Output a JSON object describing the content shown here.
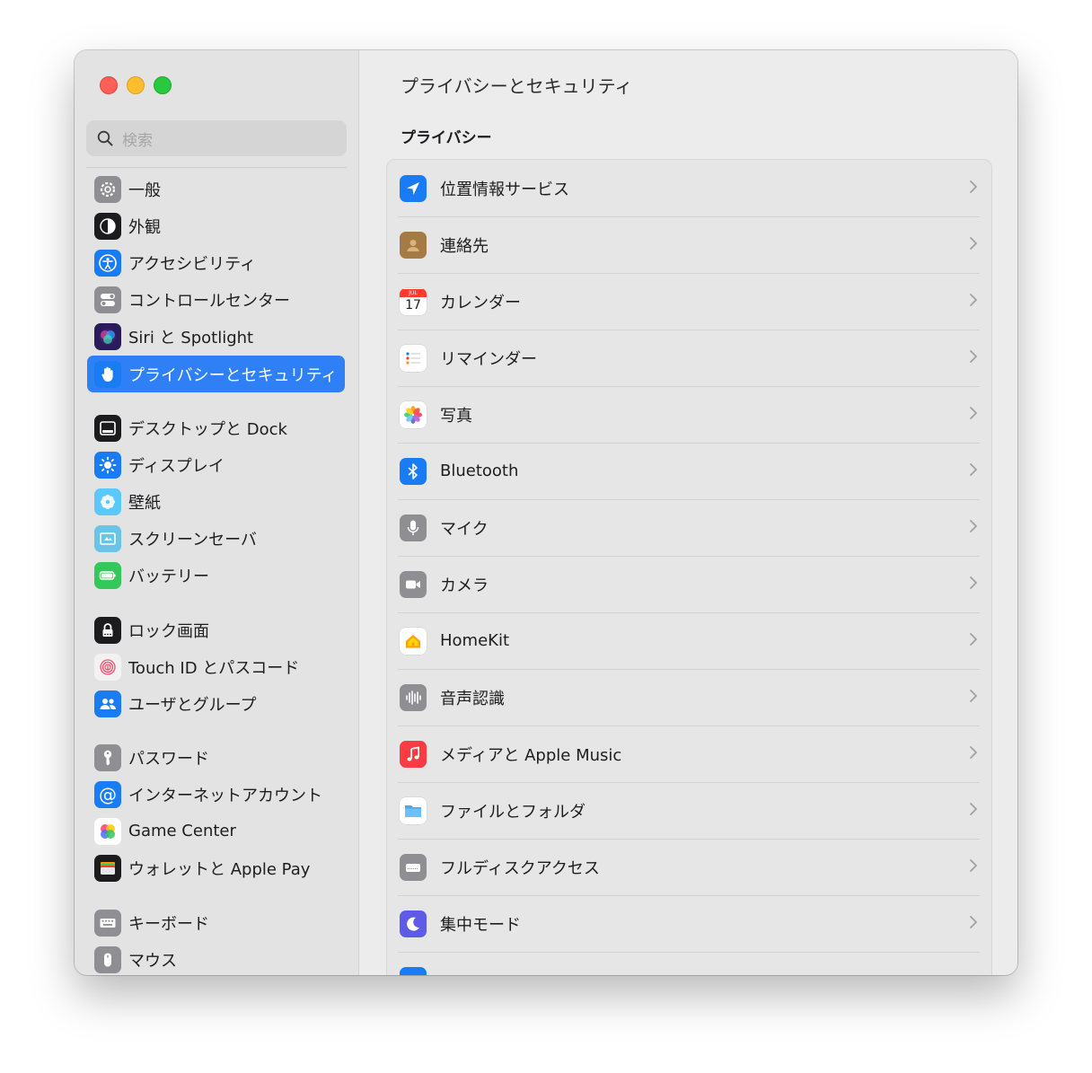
{
  "window": {
    "title": "プライバシーとセキュリティ"
  },
  "search": {
    "placeholder": "検索"
  },
  "sidebar": {
    "items": [
      {
        "label": "一般",
        "icon": "gear-icon",
        "color": "#8e8e93"
      },
      {
        "label": "外観",
        "icon": "appearance-icon",
        "color": "#1c1c1e"
      },
      {
        "label": "アクセシビリティ",
        "icon": "accessibility-icon",
        "color": "#1a7cf5"
      },
      {
        "label": "コントロールセンター",
        "icon": "control-center-icon",
        "color": "#8e8e93"
      },
      {
        "label": "Siri と Spotlight",
        "icon": "siri-icon",
        "color": "#2b1b5a"
      },
      {
        "label": "プライバシーとセキュリティ",
        "icon": "hand-icon",
        "color": "#1a7cf5",
        "selected": true
      },
      {
        "label": "デスクトップと Dock",
        "icon": "dock-icon",
        "color": "#1c1c1e"
      },
      {
        "label": "ディスプレイ",
        "icon": "display-icon",
        "color": "#1a7cf5"
      },
      {
        "label": "壁紙",
        "icon": "wallpaper-icon",
        "color": "#5ac8fa"
      },
      {
        "label": "スクリーンセーバ",
        "icon": "screensaver-icon",
        "color": "#6ac4e8"
      },
      {
        "label": "バッテリー",
        "icon": "battery-icon",
        "color": "#34c759"
      },
      {
        "label": "ロック画面",
        "icon": "lock-icon",
        "color": "#1c1c1e"
      },
      {
        "label": "Touch ID とパスコード",
        "icon": "fingerprint-icon",
        "color": "#f2f2f2"
      },
      {
        "label": "ユーザとグループ",
        "icon": "users-icon",
        "color": "#1a7cf5"
      },
      {
        "label": "パスワード",
        "icon": "key-icon",
        "color": "#8e8e93"
      },
      {
        "label": "インターネットアカウント",
        "icon": "at-icon",
        "color": "#1a7cf5"
      },
      {
        "label": "Game Center",
        "icon": "game-center-icon",
        "color": "#ffffff"
      },
      {
        "label": "ウォレットと Apple Pay",
        "icon": "wallet-icon",
        "color": "#1c1c1e"
      },
      {
        "label": "キーボード",
        "icon": "keyboard-icon",
        "color": "#8e8e93"
      },
      {
        "label": "マウス",
        "icon": "mouse-icon",
        "color": "#8e8e93"
      }
    ]
  },
  "main": {
    "title": "プライバシーとセキュリティ",
    "section_title": "プライバシー",
    "rows": [
      {
        "label": "位置情報サービス",
        "icon": "location-arrow-icon",
        "color": "#1a7cf5"
      },
      {
        "label": "連絡先",
        "icon": "contacts-icon",
        "color": "#a57a45"
      },
      {
        "label": "カレンダー",
        "icon": "calendar-icon",
        "color": "#ffffff",
        "calendar_month": "JUL",
        "calendar_day": "17"
      },
      {
        "label": "リマインダー",
        "icon": "reminders-icon",
        "color": "#ffffff"
      },
      {
        "label": "写真",
        "icon": "photos-icon",
        "color": "#ffffff"
      },
      {
        "label": "Bluetooth",
        "icon": "bluetooth-icon",
        "color": "#1a7cf5"
      },
      {
        "label": "マイク",
        "icon": "microphone-icon",
        "color": "#8e8e93"
      },
      {
        "label": "カメラ",
        "icon": "camera-icon",
        "color": "#8e8e93"
      },
      {
        "label": "HomeKit",
        "icon": "home-icon",
        "color": "#ffffff"
      },
      {
        "label": "音声認識",
        "icon": "waveform-icon",
        "color": "#8e8e93"
      },
      {
        "label": "メディアと Apple Music",
        "icon": "music-note-icon",
        "color": "#fc3c44"
      },
      {
        "label": "ファイルとフォルダ",
        "icon": "folder-icon",
        "color": "#ffffff"
      },
      {
        "label": "フルディスクアクセス",
        "icon": "disk-icon",
        "color": "#8e8e93"
      },
      {
        "label": "集中モード",
        "icon": "moon-icon",
        "color": "#5e5ce6"
      },
      {
        "label": "",
        "icon": "partial-icon",
        "color": "#1a7cf5"
      }
    ]
  }
}
